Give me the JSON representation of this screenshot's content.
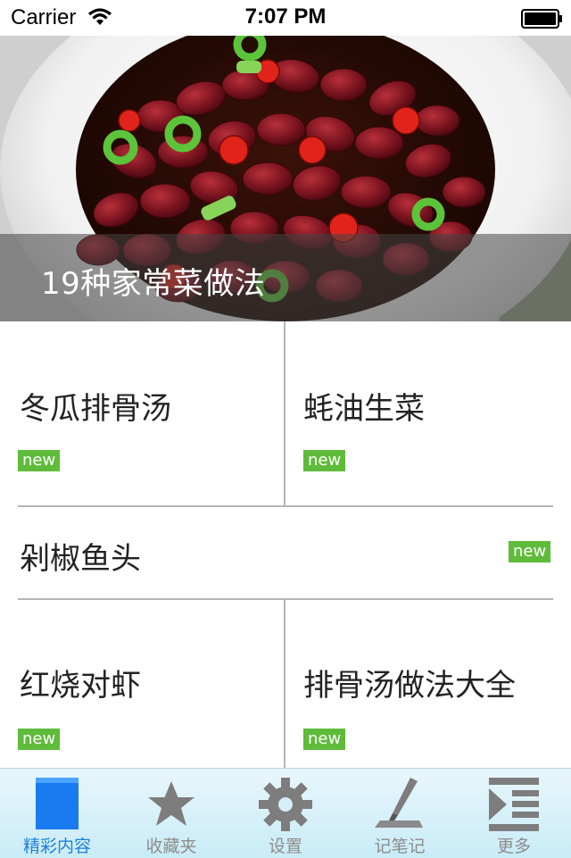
{
  "status_bar": {
    "carrier": "Carrier",
    "time": "7:07 PM"
  },
  "hero": {
    "caption": "19种家常菜做法"
  },
  "items": [
    {
      "title": "冬瓜排骨汤",
      "badge": "new"
    },
    {
      "title": "蚝油生菜",
      "badge": "new"
    },
    {
      "title": "剁椒鱼头",
      "badge": "new"
    },
    {
      "title": "红烧对虾",
      "badge": "new"
    },
    {
      "title": "排骨汤做法大全",
      "badge": "new"
    }
  ],
  "tabbar": {
    "tabs": [
      {
        "label": "精彩内容",
        "icon": "featured-icon",
        "active": true
      },
      {
        "label": "收藏夹",
        "icon": "star-icon",
        "active": false
      },
      {
        "label": "设置",
        "icon": "gear-icon",
        "active": false
      },
      {
        "label": "记笔记",
        "icon": "pen-icon",
        "active": false
      },
      {
        "label": "更多",
        "icon": "more-list-icon",
        "active": false
      }
    ]
  },
  "colors": {
    "badge": "#5fbb3a",
    "tab_active": "#1e7fd8",
    "tab_inactive": "#8c8c8c"
  }
}
